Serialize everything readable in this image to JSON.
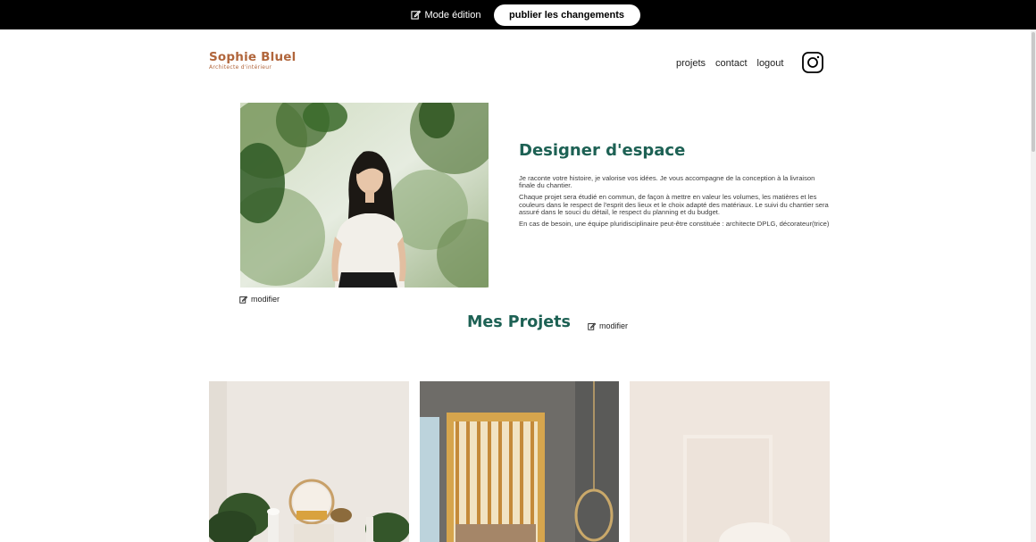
{
  "edit_bar": {
    "mode_label": "Mode édition",
    "publish_label": "publier les changements"
  },
  "header": {
    "logo_name": "Sophie Bluel",
    "logo_subtitle": "Architecte d'intérieur",
    "nav": [
      "projets",
      "contact",
      "logout"
    ],
    "instagram_icon": "instagram-icon"
  },
  "intro": {
    "photo_icon": "portrait-photo",
    "edit_label": "modifier",
    "title": "Designer d'espace",
    "paragraphs": [
      "Je raconte votre histoire, je valorise vos idées. Je vous accompagne de la conception à la livraison finale du chantier.",
      "Chaque projet sera étudié en commun, de façon à mettre en valeur les volumes, les matières et les couleurs dans le respect de l'esprit des lieux et le choix adapté des matériaux. Le suivi du chantier sera assuré dans le souci du détail, le respect du planning et du budget.",
      "En cas de besoin, une équipe pluridisciplinaire peut-être constituée : architecte DPLG, décorateur(trice)"
    ]
  },
  "projects": {
    "title": "Mes Projets",
    "edit_label": "modifier"
  },
  "colors": {
    "accent": "#1d6154",
    "brand": "#b1663c",
    "banner": "#000000"
  }
}
